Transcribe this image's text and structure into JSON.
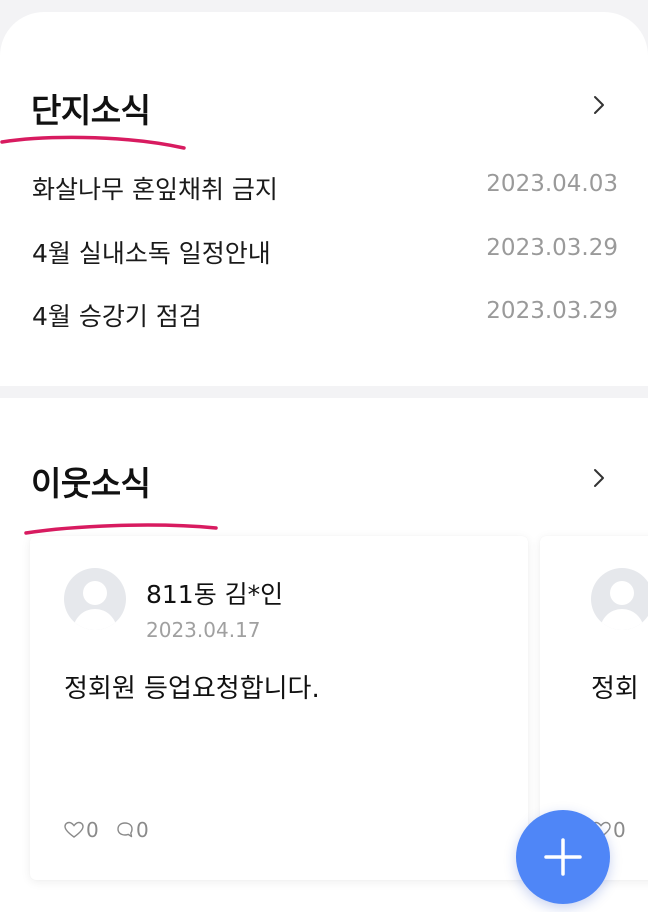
{
  "complex_news": {
    "title": "단지소식",
    "items": [
      {
        "title": "화살나무 혼잎채취 금지",
        "date": "2023.04.03"
      },
      {
        "title": "4월 실내소독 일정안내",
        "date": "2023.03.29"
      },
      {
        "title": "4월 승강기 점검",
        "date": "2023.03.29"
      }
    ]
  },
  "neighbor_news": {
    "title": "이웃소식",
    "posts": [
      {
        "author": "811동 김*인",
        "date": "2023.04.17",
        "text": "정회원 등업요청합니다.",
        "likes": "0",
        "comments": "0"
      },
      {
        "author": "",
        "date": "",
        "text": "정회",
        "likes": "0",
        "comments": ""
      }
    ]
  },
  "colors": {
    "accent_underline": "#d81b60",
    "fab": "#4f86f7",
    "date_gray": "#9a9a9a"
  },
  "icons": {
    "chevron": "chevron-right-icon",
    "like": "heart-icon",
    "comment": "comment-icon",
    "fab": "plus-icon",
    "avatar": "user-avatar-icon"
  }
}
